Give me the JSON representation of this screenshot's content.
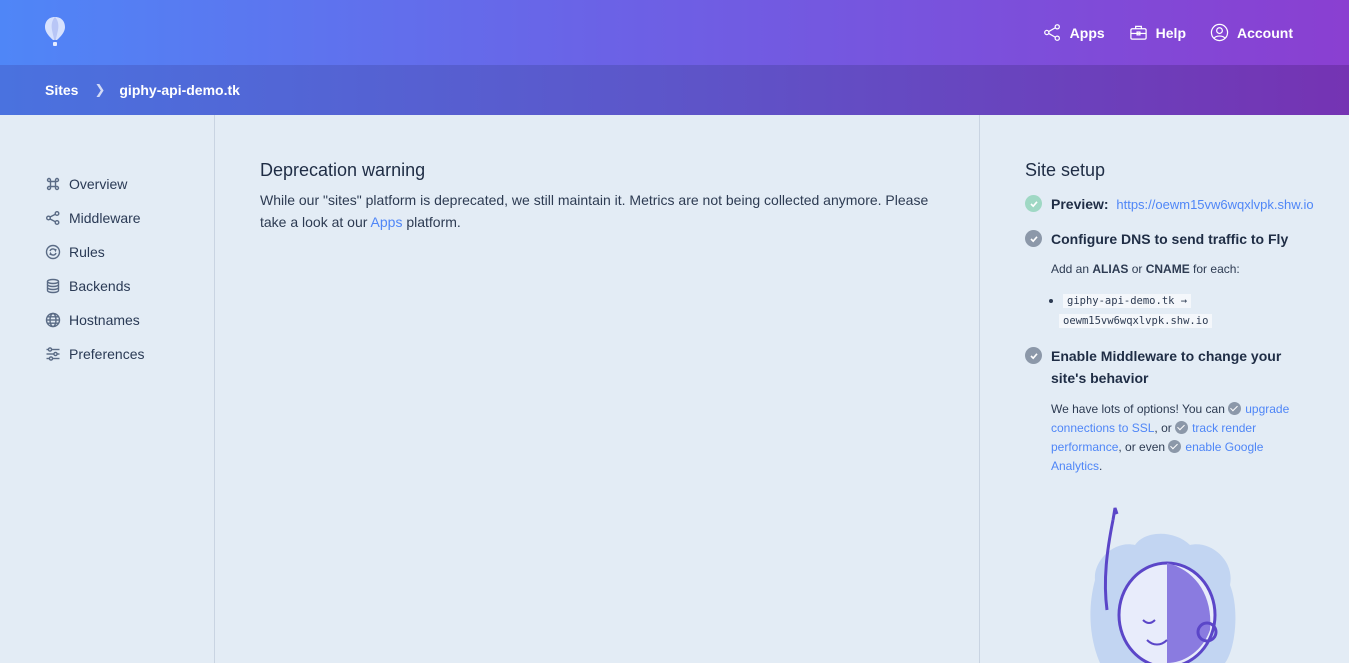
{
  "topnav": {
    "apps_label": "Apps",
    "help_label": "Help",
    "account_label": "Account"
  },
  "breadcrumb": {
    "root": "Sites",
    "current": "giphy-api-demo.tk"
  },
  "sidebar": {
    "items": [
      {
        "label": "Overview",
        "icon": "command-icon"
      },
      {
        "label": "Middleware",
        "icon": "share-nodes-icon"
      },
      {
        "label": "Rules",
        "icon": "refresh-icon"
      },
      {
        "label": "Backends",
        "icon": "database-icon"
      },
      {
        "label": "Hostnames",
        "icon": "globe-icon"
      },
      {
        "label": "Preferences",
        "icon": "sliders-icon"
      }
    ]
  },
  "main": {
    "title": "Deprecation warning",
    "text_before": "While our \"sites\" platform is deprecated, we still maintain it. Metrics are not being collected anymore. Please take a look at our ",
    "apps_link": "Apps",
    "text_after": " platform."
  },
  "setup": {
    "title": "Site setup",
    "preview_label": "Preview:",
    "preview_url": "https://oewm15vw6wqxlvpk.shw.io",
    "dns_title": "Configure DNS to send traffic to Fly",
    "dns_add": "Add an ",
    "dns_alias": "ALIAS",
    "dns_or": " or ",
    "dns_cname": "CNAME",
    "dns_each": " for each:",
    "dns_host": "giphy-api-demo.tk →",
    "dns_target": "oewm15vw6wqxlvpk.shw.io",
    "mw_title": "Enable Middleware to change your site's behavior",
    "mw_intro": "We have lots of options! You can ",
    "mw_link1": "upgrade connections to SSL",
    "mw_sep1": ", or ",
    "mw_link2": "track render performance",
    "mw_sep2": ", or even ",
    "mw_link3": "enable Google Analytics",
    "mw_end": "."
  },
  "colors": {
    "accent": "#4f86f7",
    "header_start": "#4f86f7",
    "header_end": "#8a3fd1",
    "check_done": "#9fd8c4",
    "check_pending": "#8c98a9"
  }
}
